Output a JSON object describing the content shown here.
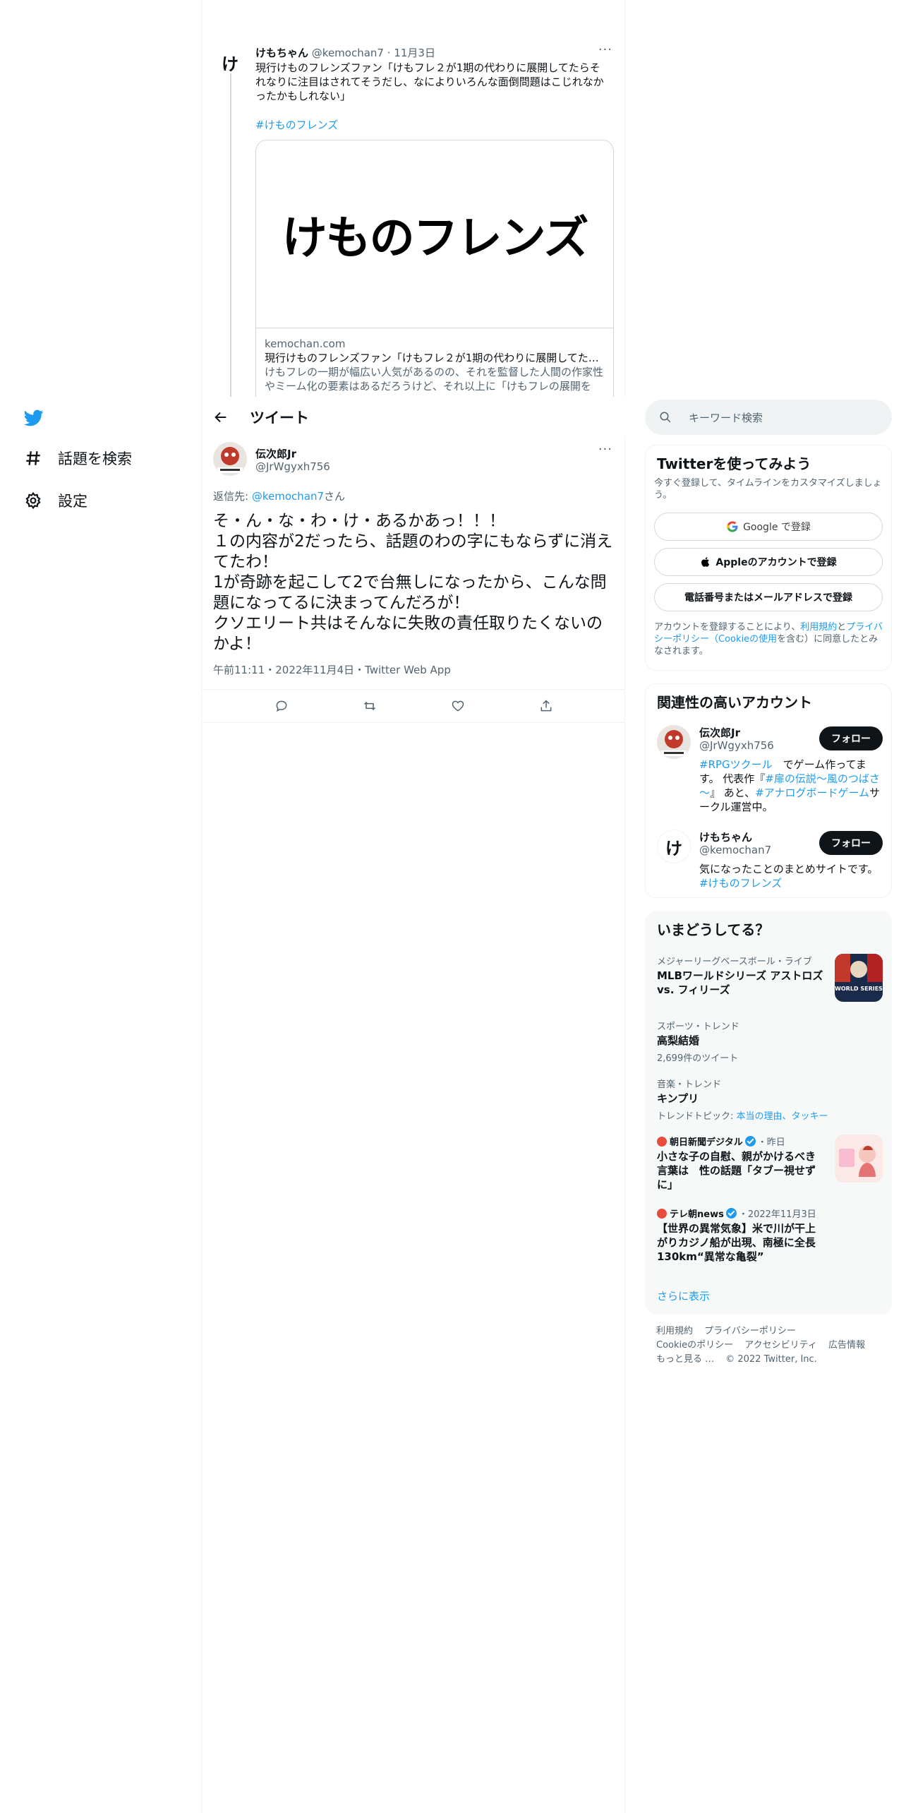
{
  "nav": {
    "explore_label": "話題を検索",
    "settings_label": "設定"
  },
  "prev_tweet": {
    "avatar_char": "け",
    "name": "けもちゃん",
    "handle": "@kemochan7",
    "sep": "·",
    "date": "11月3日",
    "more": "···",
    "text": "現行けものフレンズファン「けもフレ２が1期の代わりに展開してたらそれなりに注目はされてそうだし、なによりいろんな面倒問題はこじれなかったかもしれない」",
    "hashtag": "#けものフレンズ",
    "card": {
      "image_text": "けものフレンズ",
      "domain": "kemochan.com",
      "title": "現行けものフレンズファン「けもフレ２が1期の代わりに展開してたら…",
      "description": "けもフレの一期が幅広い人気があるのの、それを監督した人間の作家性やミーム化の要素はあるだろうけど、それ以上に「けもフレの展開を総…"
    }
  },
  "header": {
    "title": "ツイート"
  },
  "main_tweet": {
    "name": "伝次郎Jr",
    "handle": "@JrWgyxh756",
    "more": "···",
    "reply_prefix": "返信先: ",
    "reply_to": "@kemochan7",
    "reply_suffix": "さん",
    "text_lines": [
      "そ・ん・な・わ・け・あるかあっ！！！",
      "１の内容が2だったら、話題のわの字にもならずに消えてたわ！",
      "1が奇跡を起こして2で台無しになったから、こんな問題になってるに決まってんだろが！",
      "クソエリート共はそんなに失敗の責任取りたくないのかよ！"
    ],
    "meta": "午前11:11・2022年11月4日・Twitter Web App"
  },
  "search": {
    "placeholder": "キーワード検索"
  },
  "signup": {
    "title": "Twitterを使ってみよう",
    "desc": "今すぐ登録して、タイムラインをカスタマイズしましょう。",
    "google": "Google で登録",
    "apple": "Appleのアカウントで登録",
    "phone": "電話番号またはメールアドレスで登録",
    "legal_1": "アカウントを登録することにより、",
    "legal_terms": "利用規約",
    "legal_and": "と",
    "legal_privacy": "プライバシーポリシー（Cookieの使用",
    "legal_2": "を含む）に同意したとみなされます。"
  },
  "relevant": {
    "title": "関連性の高いアカウント",
    "follow_label": "フォロー",
    "accounts": [
      {
        "name": "伝次郎Jr",
        "handle": "@JrWgyxh756",
        "bio_parts": [
          "#RPGツクール",
          "　でゲーム作ってます。 代表作『",
          "#扉の伝説～風のつばさ～",
          "』 あと、",
          "#アナログボードゲーム",
          "サークル運営中。"
        ]
      },
      {
        "name": "けもちゃん",
        "handle": "@kemochan7",
        "avatar_char": "け",
        "bio": "気になったことのまとめサイトです。",
        "bio_tag": "#けものフレンズ"
      }
    ]
  },
  "trends": {
    "title": "いまどうしてる？",
    "items": [
      {
        "context": "メジャーリーグベースボール・ライブ",
        "title": "MLBワールドシリーズ アストロズ vs. フィリーズ",
        "thumb": "WORLD SERIES"
      },
      {
        "context": "スポーツ・トレンド",
        "title": "高梨結婚",
        "sub": "2,699件のツイート"
      },
      {
        "context": "音楽・トレンド",
        "title": "キンプリ",
        "sub_prefix": "トレンドトピック: ",
        "sub_link": "本当の理由、タッキー"
      },
      {
        "source": "朝日新聞デジタル",
        "time": "・昨日",
        "title": "小さな子の自慰、親がかけるべき言葉は　性の話題「タブー視せずに」"
      },
      {
        "source": "テレ朝news",
        "time": "・2022年11月3日",
        "title": "【世界の異常気象】米で川が干上がりカジノ船が出現、南極に全長130km“異常な亀裂”"
      }
    ],
    "show_more": "さらに表示"
  },
  "footer": {
    "terms": "利用規約",
    "privacy": "プライバシーポリシー",
    "cookie": "Cookieのポリシー",
    "accessibility": "アクセシビリティ",
    "ads": "広告情報",
    "more": "もっと見る …",
    "copyright": "© 2022 Twitter, Inc."
  },
  "colors": {
    "accent": "#1d9bf0",
    "text": "#0f1419",
    "muted": "#536471"
  }
}
